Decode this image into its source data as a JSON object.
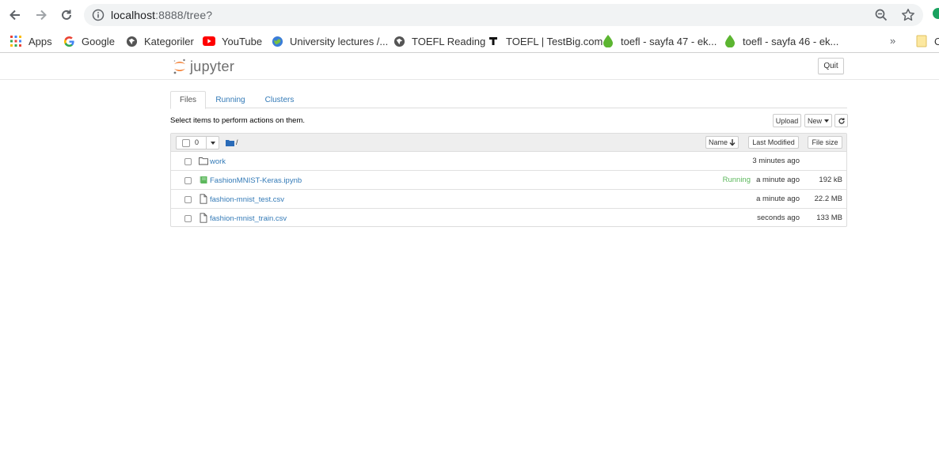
{
  "browser": {
    "url_host": "localhost",
    "url_path": ":8888/tree?",
    "bookmarks": [
      {
        "label": "Apps",
        "icon": "apps-grid-icon"
      },
      {
        "label": "Google",
        "icon": "google-icon"
      },
      {
        "label": "Kategoriler",
        "icon": "globe-icon"
      },
      {
        "label": "YouTube",
        "icon": "youtube-icon"
      },
      {
        "label": "University lectures /...",
        "icon": "globe-icon"
      },
      {
        "label": "TOEFL Reading",
        "icon": "globe-icon"
      },
      {
        "label": "TOEFL | TestBig.com",
        "icon": "testbig-icon"
      },
      {
        "label": "toefl - sayfa 47 - ek...",
        "icon": "drop-icon"
      },
      {
        "label": "toefl - sayfa 46 - ek...",
        "icon": "drop-icon"
      }
    ],
    "more_label": "»",
    "overflow_label": "O"
  },
  "header": {
    "logo_text": "jupyter",
    "quit_label": "Quit"
  },
  "tabs": [
    {
      "label": "Files",
      "active": true
    },
    {
      "label": "Running",
      "active": false
    },
    {
      "label": "Clusters",
      "active": false
    }
  ],
  "toolbar": {
    "instructions": "Select items to perform actions on them.",
    "upload_label": "Upload",
    "new_label": "New",
    "refresh_icon": "refresh-icon"
  },
  "list_header": {
    "selected_count": "0",
    "breadcrumb": "/",
    "sort_name": "Name",
    "sort_modified": "Last Modified",
    "sort_size": "File size"
  },
  "files": [
    {
      "name": "work",
      "type": "folder",
      "status": "",
      "modified": "3 minutes ago",
      "size": ""
    },
    {
      "name": "FashionMNIST-Keras.ipynb",
      "type": "notebook",
      "status": "Running",
      "modified": "a minute ago",
      "size": "192 kB"
    },
    {
      "name": "fashion-mnist_test.csv",
      "type": "file",
      "status": "",
      "modified": "a minute ago",
      "size": "22.2 MB"
    },
    {
      "name": "fashion-mnist_train.csv",
      "type": "file",
      "status": "",
      "modified": "seconds ago",
      "size": "133 MB"
    }
  ],
  "colors": {
    "link": "#337ab7",
    "running": "#5cb85c",
    "jupyter_orange": "#f37726"
  }
}
